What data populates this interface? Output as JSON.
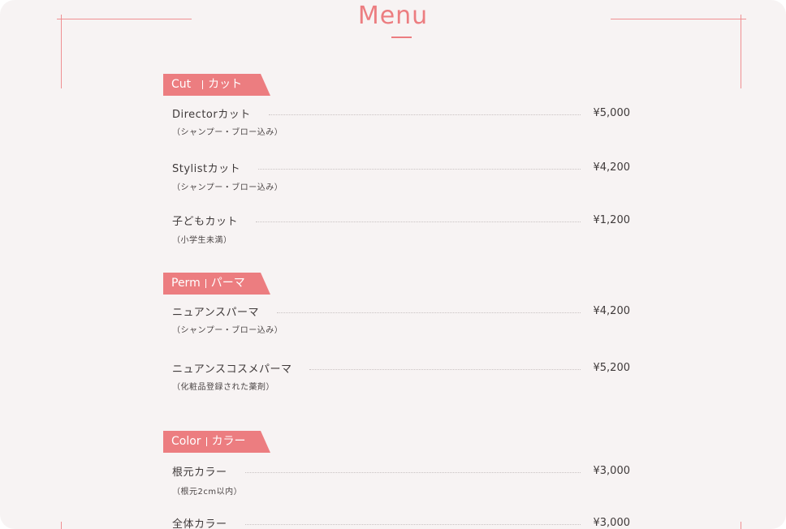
{
  "title": "Menu",
  "colors": {
    "accent": "#ec7d80",
    "background": "#f7f3f3",
    "text": "#3f3a3a"
  },
  "sections": [
    {
      "en": "Cut",
      "ja": "カット",
      "items": [
        {
          "name": "Directorカット",
          "price": "¥5,000",
          "note": "（シャンプー・ブロー込み）"
        },
        {
          "name": "Stylistカット",
          "price": "¥4,200",
          "note": "（シャンプー・ブロー込み）"
        },
        {
          "name": "子どもカット",
          "price": "¥1,200",
          "note": "（小学生未満）"
        }
      ]
    },
    {
      "en": "Perm",
      "ja": "パーマ",
      "items": [
        {
          "name": "ニュアンスパーマ",
          "price": "¥4,200",
          "note": "（シャンプー・ブロー込み）"
        },
        {
          "name": "ニュアンスコスメパーマ",
          "price": "¥5,200",
          "note": "（化粧品登録された薬剤）"
        }
      ]
    },
    {
      "en": "Color",
      "ja": "カラー",
      "items": [
        {
          "name": "根元カラー",
          "price": "¥3,000",
          "note": "（根元2cm以内）"
        },
        {
          "name": "全体カラー",
          "price": "¥3,000"
        }
      ]
    }
  ]
}
